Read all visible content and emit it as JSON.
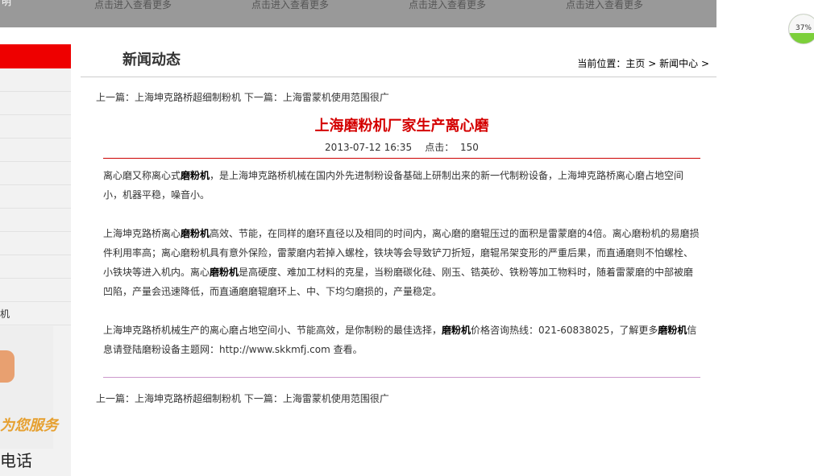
{
  "topbar": {
    "cutoff_text": "明",
    "links": [
      "点击进入查看更多",
      "点击进入查看更多",
      "点击进入查看更多",
      "点击进入查看更多"
    ]
  },
  "sidebar": {
    "partial_item_text": "机",
    "promo_service_text": "为您服务",
    "promo_phone_text": "电话"
  },
  "header": {
    "title": "新闻动态",
    "breadcrumb_prefix": "当前位置：",
    "breadcrumb_home": "主页",
    "breadcrumb_sep1": " > ",
    "breadcrumb_section": "新闻中心",
    "breadcrumb_sep2": " >"
  },
  "prevnext": {
    "prev_label": "上一篇：",
    "prev_title": "上海坤克路桥超细制粉机",
    "next_label": " 下一篇：",
    "next_title": "上海雷蒙机使用范围很广"
  },
  "article": {
    "title": "上海磨粉机厂家生产离心磨",
    "date": "2013-07-12 16:35",
    "clicks_label": "点击：",
    "clicks_value": "150",
    "p1_a": "离心磨又称离心式",
    "p1_kw": "磨粉机",
    "p1_b": "，是上海坤克路桥机械在国内外先进制粉设备基础上研制出来的新一代制粉设备，上海坤克路桥离心磨占地空间小，机器平稳，噪音小。",
    "p2_a": "上海坤克路桥离心",
    "p2_kw1": "磨粉机",
    "p2_b": "高效、节能，在同样的磨环直径以及相同的时间内，离心磨的磨辊压过的面积是雷蒙磨的4倍。离心磨粉机的易磨损件利用率高；离心磨粉机具有意外保险，雷蒙磨内若掉入螺栓，铁块等会导致铲刀折短，磨辊吊架变形的严重后果，而直通磨则不怕螺栓、小铁块等进入机内。离心",
    "p2_kw2": "磨粉机",
    "p2_c": "是高硬度、难加工材料的克星，当粉磨碳化硅、刚玉、锆英砂、铁粉等加工物料时，随着雷蒙磨的中部被磨凹陷，产量会迅速降低，而直通磨磨辊磨环上、中、下均匀磨损的，产量稳定。",
    "p3_a": "上海坤克路桥机械生产的离心磨占地空间小、节能高效，是你制粉的最佳选择，",
    "p3_kw1": "磨粉机",
    "p3_b": "价格咨询热线：021-60838025，了解更多",
    "p3_kw2": "磨粉机",
    "p3_c": "信息请登陆磨粉设备主题网：http://www.skkmfj.com 查看。"
  },
  "progress": {
    "value_text": "37%",
    "fraction": 0.37
  }
}
